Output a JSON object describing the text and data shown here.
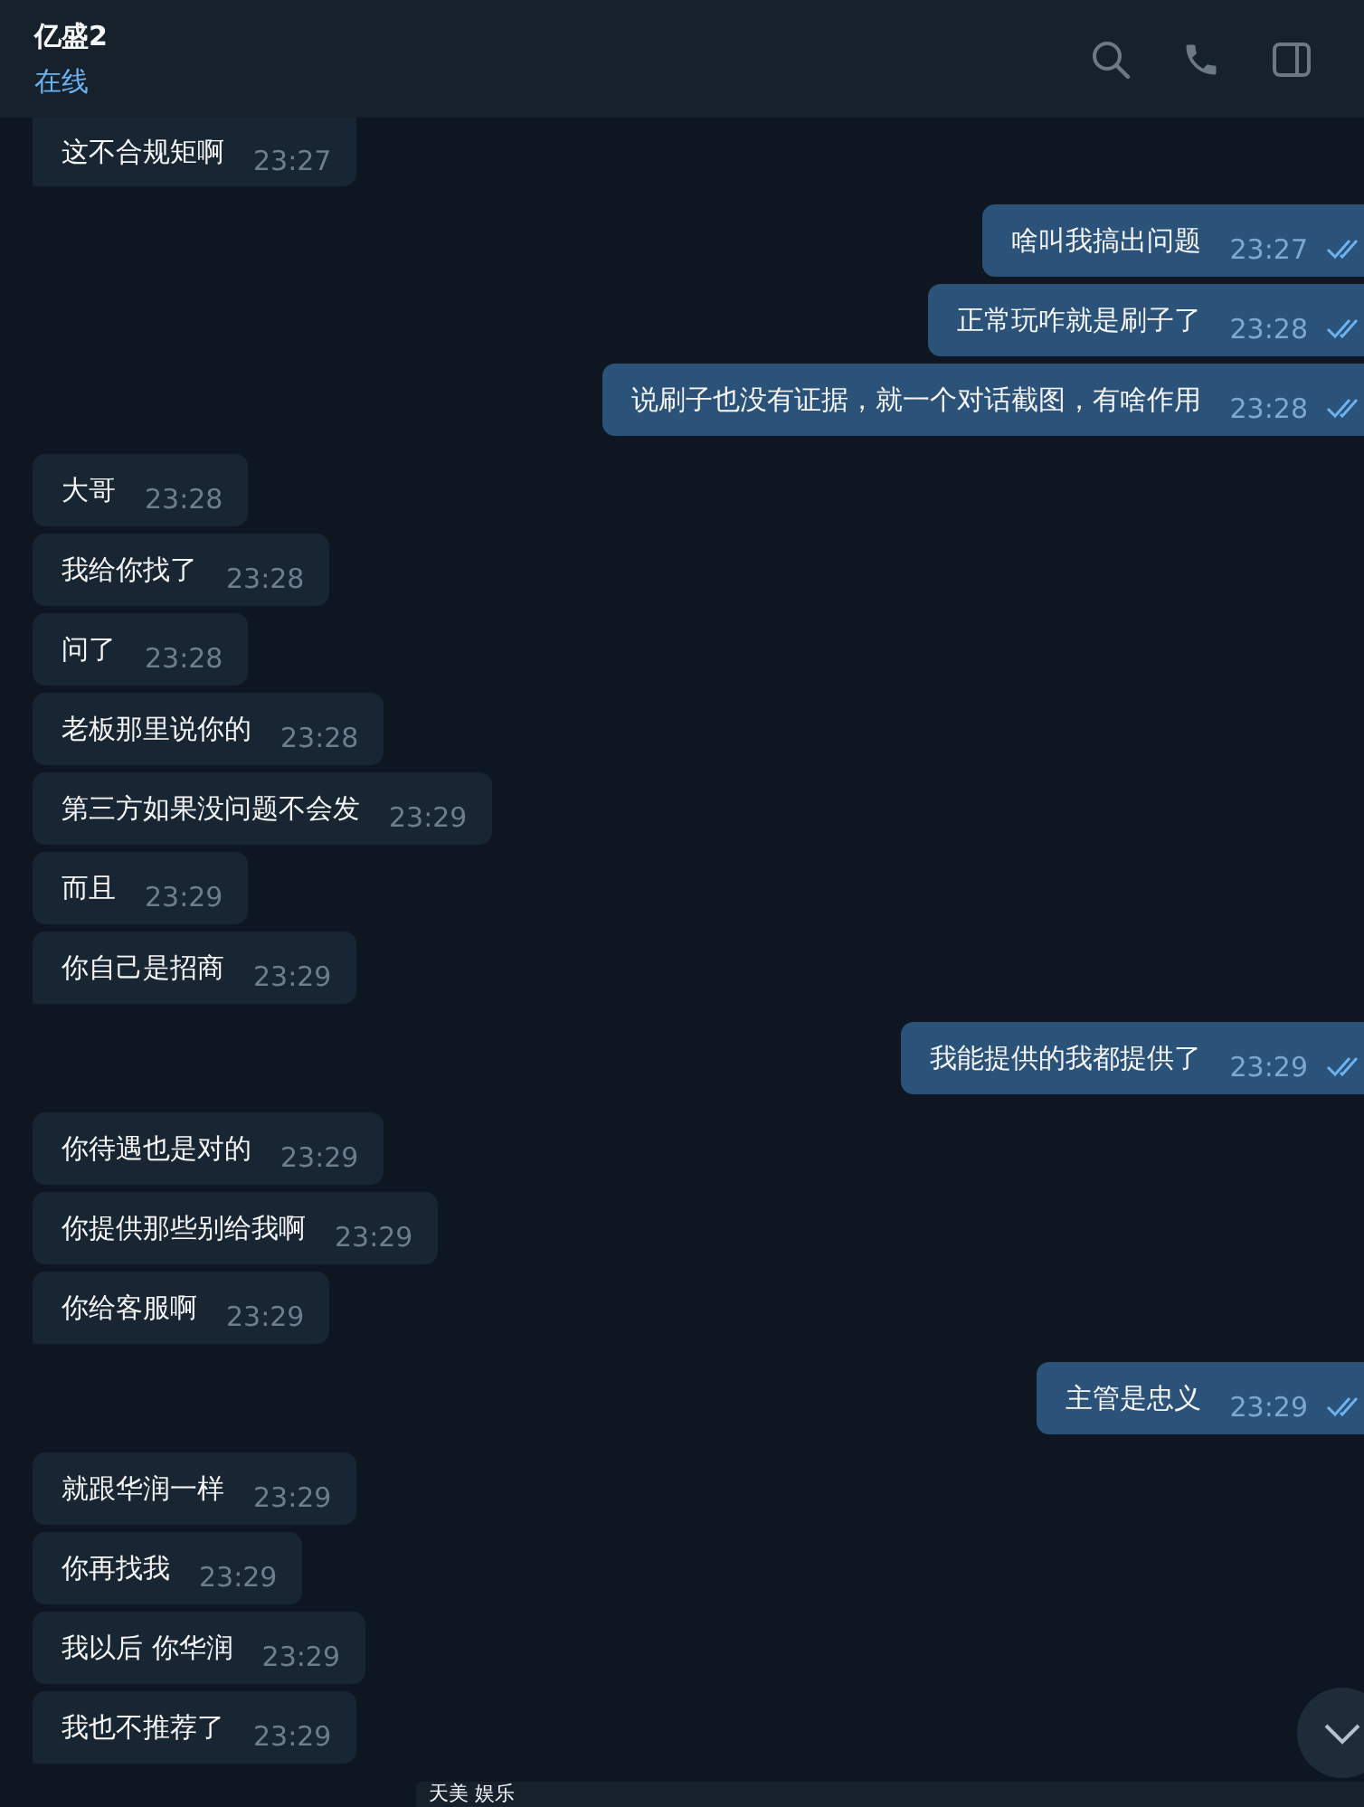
{
  "header": {
    "title": "亿盛2",
    "status": "在线"
  },
  "groups": [
    {
      "kind": "incoming",
      "messages": [
        {
          "text": "这不合规矩啊",
          "time": "23:27"
        }
      ]
    },
    {
      "kind": "outgoing",
      "messages": [
        {
          "text": "啥叫我搞出问题",
          "time": "23:27",
          "read": true
        },
        {
          "text": "正常玩咋就是刷子了",
          "time": "23:28",
          "read": true
        },
        {
          "text": "说刷子也没有证据，就一个对话截图，有啥作用",
          "time": "23:28",
          "read": true
        }
      ]
    },
    {
      "kind": "incoming",
      "messages": [
        {
          "text": "大哥",
          "time": "23:28"
        },
        {
          "text": "我给你找了",
          "time": "23:28"
        },
        {
          "text": "问了",
          "time": "23:28"
        },
        {
          "text": "老板那里说你的",
          "time": "23:28"
        },
        {
          "text": "第三方如果没问题不会发",
          "time": "23:29"
        },
        {
          "text": "而且",
          "time": "23:29"
        },
        {
          "text": "你自己是招商",
          "time": "23:29"
        }
      ]
    },
    {
      "kind": "outgoing",
      "messages": [
        {
          "text": "我能提供的我都提供了",
          "time": "23:29",
          "read": true
        }
      ]
    },
    {
      "kind": "incoming",
      "messages": [
        {
          "text": "你待遇也是对的",
          "time": "23:29"
        },
        {
          "text": "你提供那些别给我啊",
          "time": "23:29"
        },
        {
          "text": "你给客服啊",
          "time": "23:29"
        }
      ]
    },
    {
      "kind": "outgoing",
      "messages": [
        {
          "text": "主管是忠义",
          "time": "23:29",
          "read": true
        }
      ]
    },
    {
      "kind": "incoming",
      "messages": [
        {
          "text": "就跟华润一样",
          "time": "23:29"
        },
        {
          "text": "你再找我",
          "time": "23:29"
        },
        {
          "text": "我以后 你华润",
          "time": "23:29"
        },
        {
          "text": "我也不推荐了",
          "time": "23:29"
        }
      ]
    }
  ],
  "bottom_bar": {
    "title": "天美 娱乐"
  }
}
